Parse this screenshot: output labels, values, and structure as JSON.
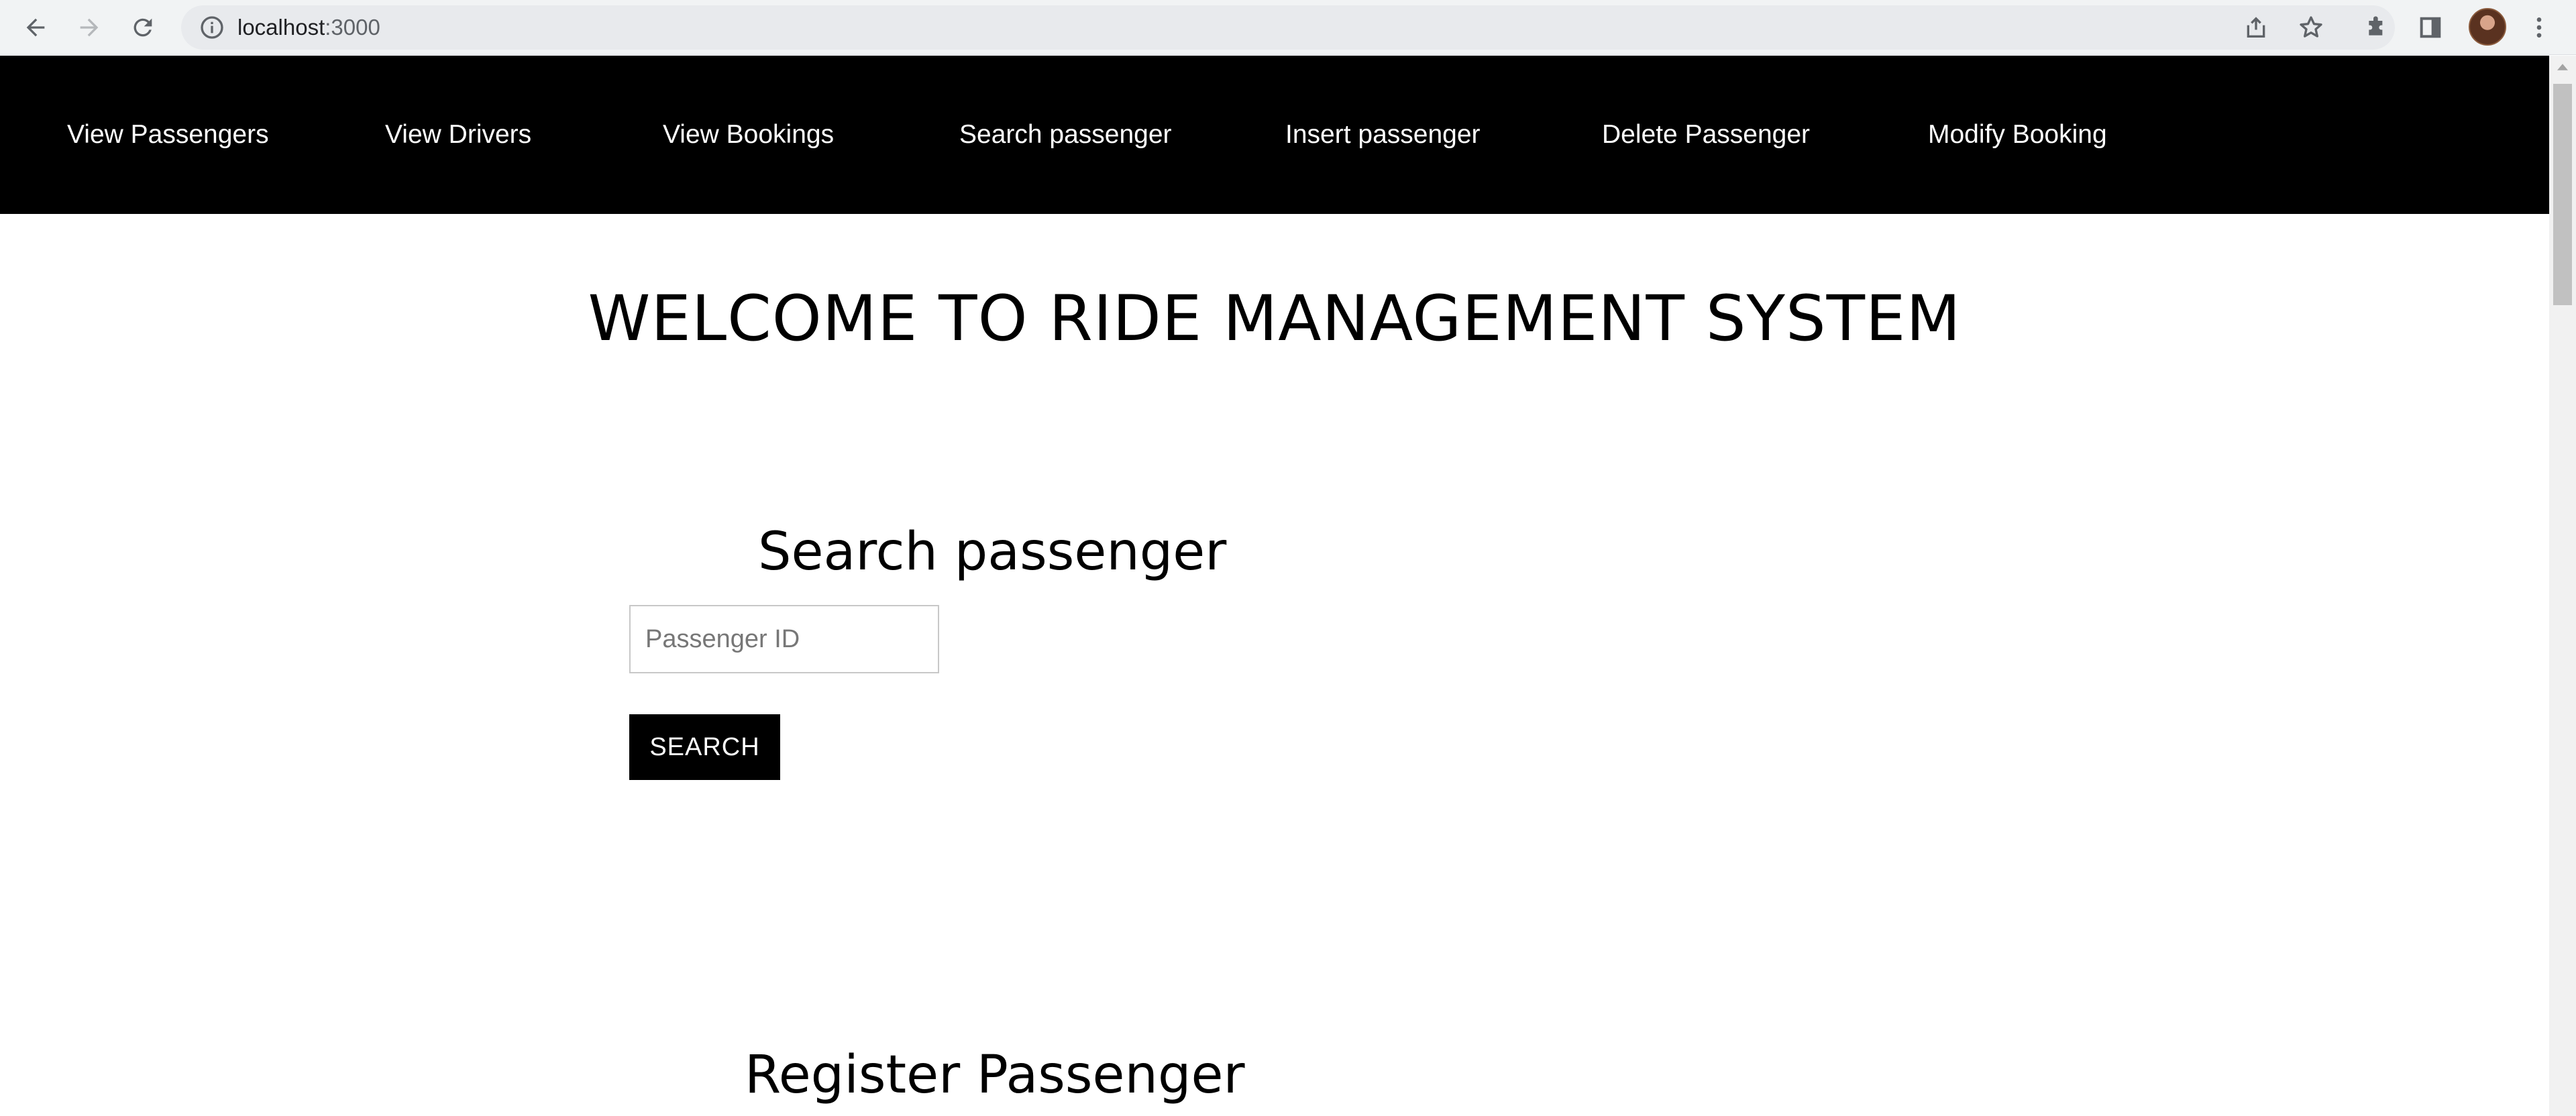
{
  "browser": {
    "url_host": "localhost",
    "url_port": ":3000",
    "icons": [
      "back-arrow-icon",
      "forward-arrow-icon",
      "reload-icon",
      "info-icon",
      "share-icon",
      "bookmark-star-icon",
      "extensions-puzzle-icon",
      "side-panel-icon",
      "profile-avatar",
      "kebab-menu-icon"
    ]
  },
  "navbar": {
    "items": [
      {
        "label": "View Passengers"
      },
      {
        "label": "View Drivers"
      },
      {
        "label": "View Bookings"
      },
      {
        "label": "Search passenger"
      },
      {
        "label": "Insert passenger"
      },
      {
        "label": "Delete Passenger"
      },
      {
        "label": "Modify Booking"
      }
    ],
    "background": "#000000",
    "text_color": "#ffffff"
  },
  "main": {
    "welcome": "WELCOME TO RIDE MANAGEMENT SYSTEM",
    "search_section": {
      "title": "Search passenger",
      "input_placeholder": "Passenger ID",
      "input_value": "",
      "button_label": "SEARCH"
    },
    "register_section": {
      "title": "Register Passenger"
    }
  }
}
